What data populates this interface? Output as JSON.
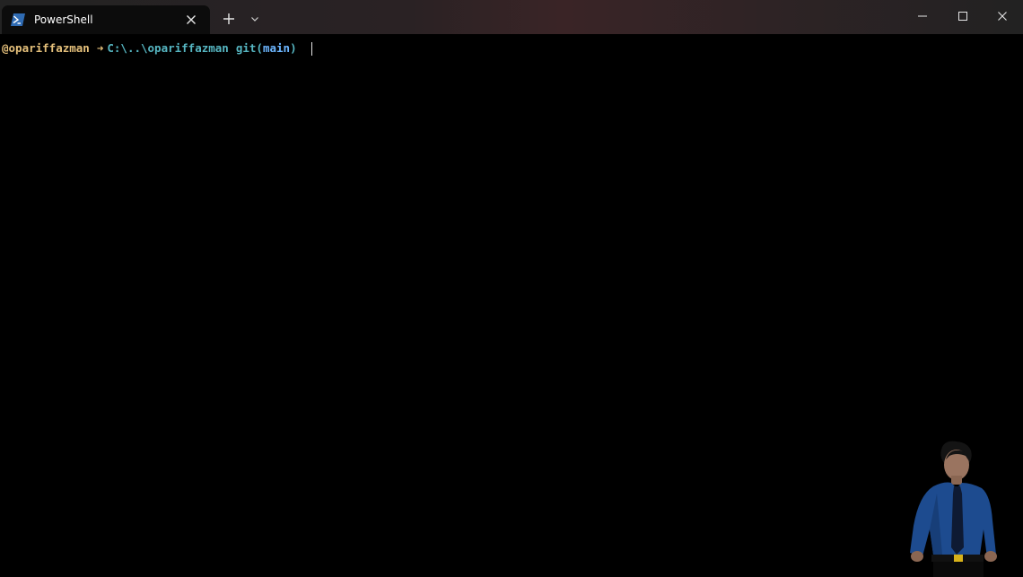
{
  "window": {
    "tab_title": "PowerShell",
    "tab_icon": "powershell-icon",
    "new_tab_icon": "plus-icon",
    "dropdown_icon": "chevron-down-icon",
    "controls": {
      "minimize_icon": "minimize-icon",
      "maximize_icon": "maximize-icon",
      "close_icon": "close-icon"
    }
  },
  "terminal": {
    "prompt": {
      "user": "@opariffazman",
      "arrow": "➜",
      "path": "C:\\..\\opariffazman",
      "git_prefix": "git(",
      "branch": "main",
      "git_suffix": ")"
    }
  },
  "colors": {
    "user": "#e5c07b",
    "path": "#56b6c2",
    "branch": "#6cb6ff",
    "background": "#000000"
  }
}
